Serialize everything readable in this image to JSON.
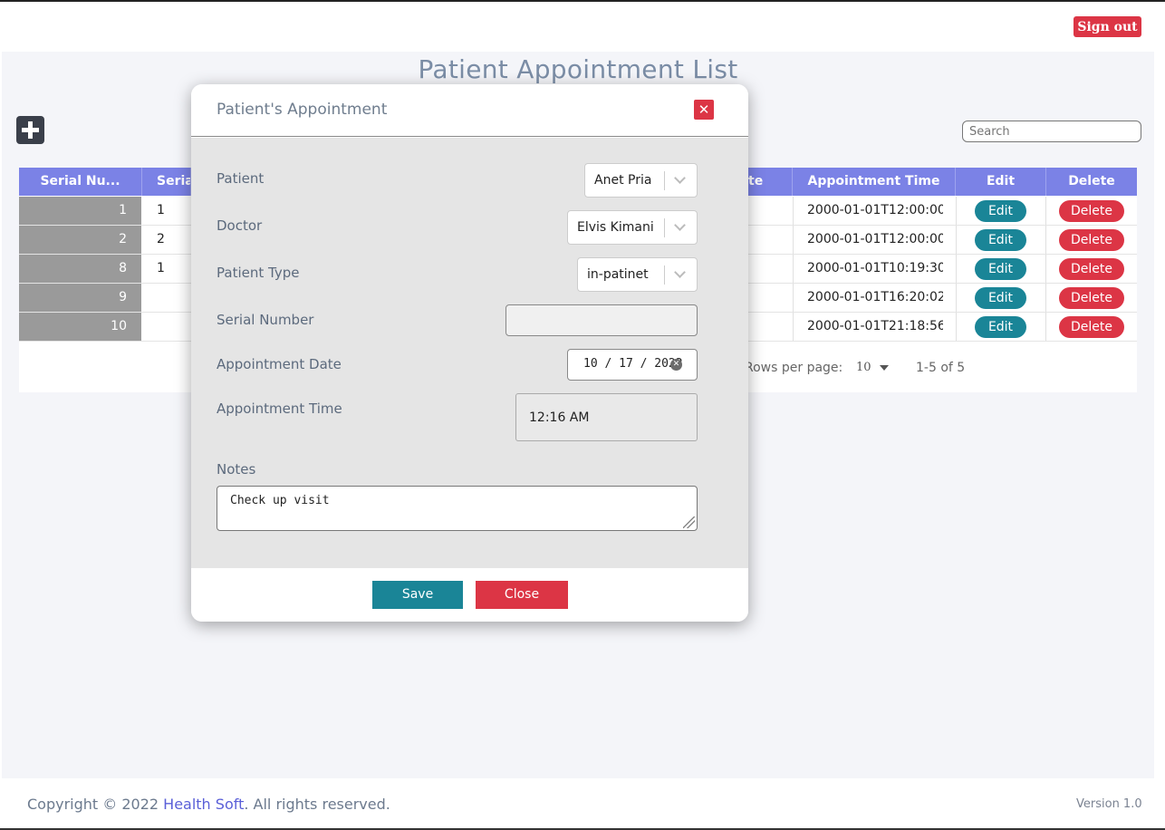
{
  "header": {
    "signout_label": "Sign out"
  },
  "page": {
    "title": "Patient Appointment List"
  },
  "toolbar": {
    "add_icon": "plus-icon",
    "search_placeholder": "Search"
  },
  "table": {
    "headers": [
      "Serial Nu...",
      "Seria",
      "te",
      "Appointment Time",
      "Edit",
      "Delete"
    ],
    "rows": [
      {
        "serial": "1",
        "serial2": "1",
        "time": "2000-01-01T12:00:00...",
        "edit": "Edit",
        "delete": "Delete"
      },
      {
        "serial": "2",
        "serial2": "2",
        "time": "2000-01-01T12:00:00...",
        "edit": "Edit",
        "delete": "Delete"
      },
      {
        "serial": "8",
        "serial2": "1",
        "time": "2000-01-01T10:19:30....",
        "edit": "Edit",
        "delete": "Delete"
      },
      {
        "serial": "9",
        "serial2": "",
        "time": "2000-01-01T16:20:02...",
        "edit": "Edit",
        "delete": "Delete"
      },
      {
        "serial": "10",
        "serial2": "",
        "time": "2000-01-01T21:18:56....",
        "edit": "Edit",
        "delete": "Delete"
      }
    ],
    "pagination": {
      "rows_label": "Rows per page:",
      "rows_value": "10",
      "count": "1-5 of 5"
    }
  },
  "modal": {
    "title": "Patient's Appointment",
    "close_icon": "close-icon",
    "fields": {
      "patient": {
        "label": "Patient",
        "value": "Anet Pria"
      },
      "doctor": {
        "label": "Doctor",
        "value": "Elvis Kimani"
      },
      "patient_type": {
        "label": "Patient Type",
        "value": "in-patinet"
      },
      "serial_number": {
        "label": "Serial Number",
        "value": ""
      },
      "appointment_date": {
        "label": "Appointment Date",
        "value": "10 / 17 / 2022"
      },
      "appointment_time": {
        "label": "Appointment Time",
        "value": "12:16 AM"
      },
      "notes": {
        "label": "Notes",
        "value": "Check up visit"
      }
    },
    "save_label": "Save",
    "close_label": "Close"
  },
  "footer": {
    "copyright_prefix": "Copyright © 2022 ",
    "brand": "Health Soft",
    "copyright_suffix": ". All rights reserved.",
    "version": "Version 1.0"
  },
  "colors": {
    "accent": "#7b82e6",
    "danger": "#dc3545",
    "primary": "#1a8597"
  }
}
